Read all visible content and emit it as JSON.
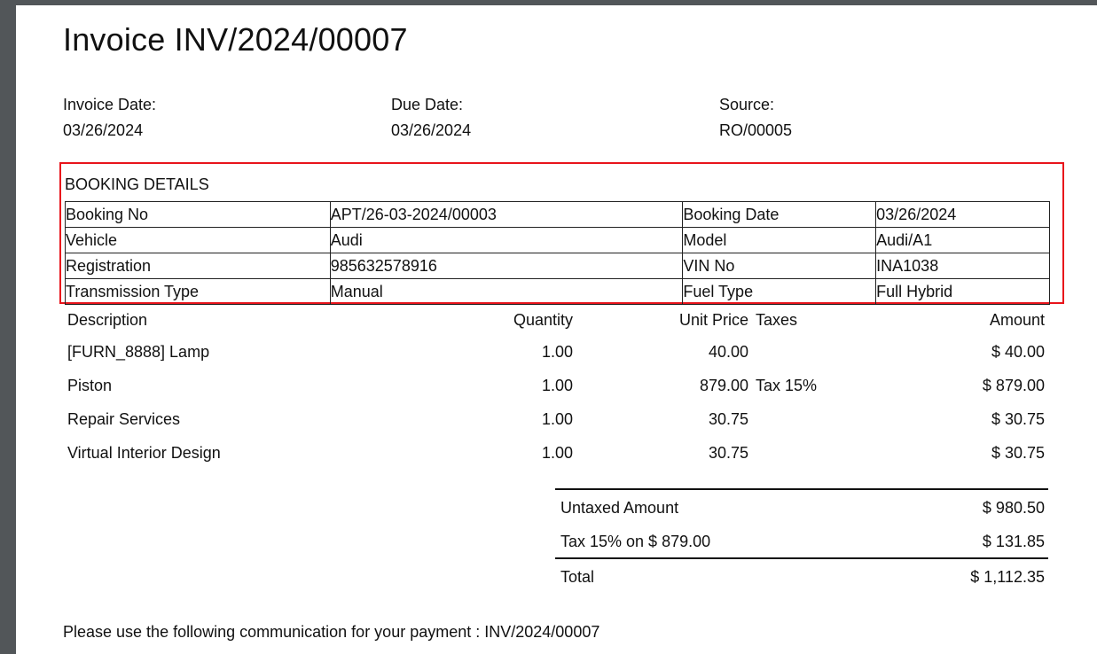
{
  "invoice": {
    "title": "Invoice INV/2024/00007",
    "meta": [
      {
        "label": "Invoice Date:",
        "value": "03/26/2024"
      },
      {
        "label": "Due Date:",
        "value": "03/26/2024"
      },
      {
        "label": "Source:",
        "value": "RO/00005"
      }
    ]
  },
  "booking": {
    "heading": "BOOKING DETAILS",
    "rows": [
      [
        "Booking No",
        "APT/26-03-2024/00003",
        "Booking Date",
        "03/26/2024"
      ],
      [
        "Vehicle",
        "Audi",
        "Model",
        "Audi/A1"
      ],
      [
        "Registration",
        "985632578916",
        "VIN No",
        "INA1038"
      ],
      [
        "Transmission Type",
        "Manual",
        "Fuel Type",
        "Full Hybrid"
      ]
    ]
  },
  "lines": {
    "headers": {
      "description": "Description",
      "quantity": "Quantity",
      "unit_price": "Unit Price",
      "taxes": "Taxes",
      "amount": "Amount"
    },
    "items": [
      {
        "description": "[FURN_8888] Lamp",
        "quantity": "1.00",
        "unit_price": "40.00",
        "taxes": "",
        "amount": "$ 40.00"
      },
      {
        "description": "Piston",
        "quantity": "1.00",
        "unit_price": "879.00",
        "taxes": "Tax 15%",
        "amount": "$ 879.00"
      },
      {
        "description": "Repair Services",
        "quantity": "1.00",
        "unit_price": "30.75",
        "taxes": "",
        "amount": "$ 30.75"
      },
      {
        "description": "Virtual Interior Design",
        "quantity": "1.00",
        "unit_price": "30.75",
        "taxes": "",
        "amount": "$ 30.75"
      }
    ]
  },
  "totals": {
    "untaxed_label": "Untaxed Amount",
    "untaxed_value": "$ 980.50",
    "tax_label": "Tax 15% on $ 879.00",
    "tax_value": "$ 131.85",
    "total_label": "Total",
    "total_value": "$ 1,112.35"
  },
  "communication": "Please use the following communication for your payment : INV/2024/00007",
  "colors": {
    "highlight_border": "#e8141b",
    "viewer_background": "#525659"
  }
}
